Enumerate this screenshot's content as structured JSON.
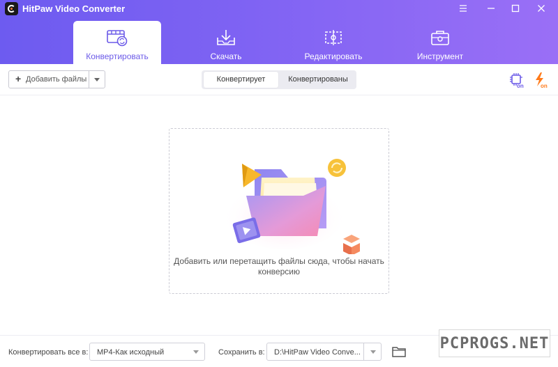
{
  "app": {
    "title": "HitPaw Video Converter",
    "accent": "#6b5ae8"
  },
  "window_controls": [
    "menu-icon",
    "minimize-icon",
    "maximize-icon",
    "close-icon"
  ],
  "tabs": [
    {
      "label": "Конвертировать",
      "icon": "convert-film-icon",
      "active": true
    },
    {
      "label": "Скачать",
      "icon": "download-tray-icon",
      "active": false
    },
    {
      "label": "Редактировать",
      "icon": "edit-crop-icon",
      "active": false
    },
    {
      "label": "Инструмент",
      "icon": "toolbox-icon",
      "active": false
    }
  ],
  "toolbar": {
    "add_files_label": "Добавить файлы",
    "segments": [
      "Конвертирует",
      "Конвертированы"
    ],
    "hw_accel_badge": "on",
    "turbo_badge": "on"
  },
  "dropzone": {
    "text": "Добавить или перетащить файлы сюда, чтобы начать конверсию"
  },
  "bottom": {
    "convert_all_label": "Конвертировать все в:",
    "format_value": "MP4-Как исходный",
    "save_label": "Сохранить в:",
    "save_path": "D:\\HitPaw Video Conve..."
  },
  "watermark": "PCPROGS.NET"
}
